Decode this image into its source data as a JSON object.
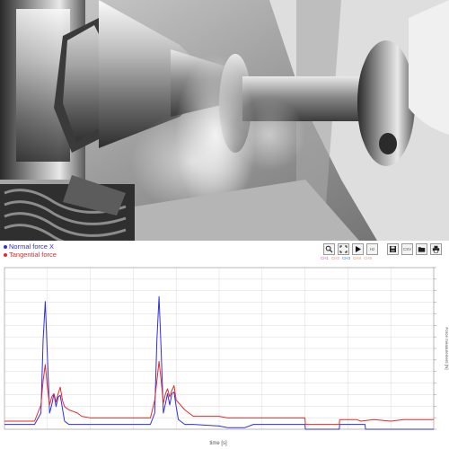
{
  "colors": {
    "normal": "#2f2fe6",
    "tangential": "#e52a2a",
    "grid": "#d9d9d9",
    "axis": "#8a8a8a",
    "ch1": "#d256d2",
    "ch2": "#f08a8a",
    "ch3": "#3c78d8",
    "ch4": "#e89a3c",
    "ch5": "#d9a0a0"
  },
  "toolbar": {
    "icons": [
      "zoom-icon",
      "fit-icon",
      "play-icon",
      "record-icon",
      "save-icon",
      "csv-icon",
      "folder-icon",
      "print-icon"
    ],
    "hz_label": "Hz",
    "csv_label": "CSV",
    "channels": [
      "CH1",
      "CH2",
      "CH3",
      "CH4",
      "CH5"
    ]
  },
  "chart_data": {
    "type": "line",
    "xlabel": "time [s]",
    "ylabel": "Force measurement [N]",
    "xlim": [
      0,
      1
    ],
    "ylim": [
      0,
      1
    ],
    "grid": true,
    "legend_position": "top-left",
    "series": [
      {
        "name": "Normal force X",
        "color_key": "normal",
        "x": [
          0.0,
          0.07,
          0.085,
          0.09,
          0.095,
          0.1,
          0.105,
          0.11,
          0.115,
          0.12,
          0.125,
          0.13,
          0.135,
          0.14,
          0.145,
          0.15,
          0.16,
          0.17,
          0.2,
          0.3,
          0.34,
          0.35,
          0.355,
          0.36,
          0.365,
          0.37,
          0.375,
          0.38,
          0.385,
          0.39,
          0.395,
          0.4,
          0.405,
          0.41,
          0.42,
          0.44,
          0.5,
          0.52,
          0.56,
          0.58,
          0.6,
          0.66,
          0.7,
          0.701,
          0.76,
          0.78,
          0.781,
          0.84,
          0.841,
          0.86,
          0.9,
          0.93,
          1.0
        ],
        "y": [
          0.03,
          0.03,
          0.1,
          0.55,
          0.79,
          0.45,
          0.1,
          0.15,
          0.22,
          0.14,
          0.2,
          0.21,
          0.13,
          0.05,
          0.04,
          0.03,
          0.03,
          0.03,
          0.03,
          0.03,
          0.03,
          0.1,
          0.55,
          0.82,
          0.48,
          0.1,
          0.16,
          0.22,
          0.15,
          0.22,
          0.23,
          0.14,
          0.06,
          0.05,
          0.03,
          0.03,
          0.02,
          0.01,
          0.01,
          0.03,
          0.03,
          0.03,
          0.03,
          0.0,
          0.0,
          0.0,
          0.03,
          0.03,
          0.0,
          0.0,
          0.0,
          0.0,
          0.0
        ]
      },
      {
        "name": "Tangential force",
        "color_key": "tangential",
        "x": [
          0.0,
          0.07,
          0.085,
          0.09,
          0.095,
          0.1,
          0.105,
          0.11,
          0.115,
          0.12,
          0.125,
          0.13,
          0.135,
          0.14,
          0.15,
          0.16,
          0.17,
          0.18,
          0.2,
          0.3,
          0.34,
          0.35,
          0.355,
          0.36,
          0.365,
          0.37,
          0.375,
          0.38,
          0.385,
          0.39,
          0.395,
          0.4,
          0.41,
          0.42,
          0.43,
          0.44,
          0.5,
          0.52,
          0.6,
          0.7,
          0.701,
          0.78,
          0.781,
          0.82,
          0.83,
          0.86,
          0.9,
          0.93,
          0.96,
          1.0
        ],
        "y": [
          0.05,
          0.05,
          0.15,
          0.3,
          0.4,
          0.26,
          0.15,
          0.2,
          0.22,
          0.17,
          0.22,
          0.26,
          0.18,
          0.14,
          0.12,
          0.11,
          0.1,
          0.08,
          0.07,
          0.07,
          0.07,
          0.18,
          0.3,
          0.42,
          0.3,
          0.16,
          0.22,
          0.25,
          0.2,
          0.24,
          0.27,
          0.18,
          0.15,
          0.12,
          0.1,
          0.08,
          0.08,
          0.07,
          0.07,
          0.07,
          0.03,
          0.03,
          0.06,
          0.06,
          0.05,
          0.06,
          0.05,
          0.06,
          0.06,
          0.06
        ]
      }
    ]
  }
}
